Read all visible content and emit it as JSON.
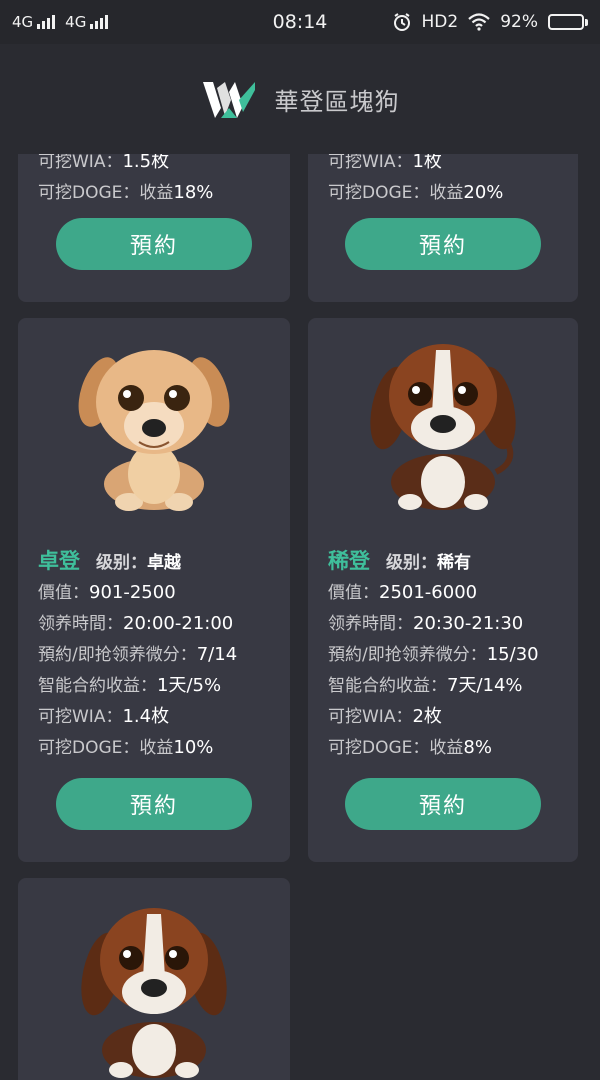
{
  "status_bar": {
    "signal1": "4G",
    "signal2": "4G",
    "time": "08:14",
    "hd": "HD2",
    "battery": "92%",
    "battery_level": 0.92
  },
  "header": {
    "title": "華登區塊狗",
    "logo_icon": "w-logo-icon"
  },
  "colors": {
    "accent": "#3fbf9b",
    "button": "#3ea88a",
    "card_bg": "#383943",
    "page_bg": "#2a2b31"
  },
  "partial_cards": [
    {
      "wia_label": "可挖WIA：",
      "wia_value": "1.5枚",
      "doge_label": "可挖DOGE：收益",
      "doge_value": "18%",
      "button": "預約"
    },
    {
      "wia_label": "可挖WIA：",
      "wia_value": "1枚",
      "doge_label": "可挖DOGE：收益",
      "doge_value": "20%",
      "button": "預約"
    }
  ],
  "cards": [
    {
      "name": "卓登",
      "level_label": "级别：",
      "level": "卓越",
      "price_label": "價值：",
      "price": "901-2500",
      "time_label": "领养時間：",
      "time": "20:00-21:00",
      "reserve_label": "預約/即抢领养微分：",
      "reserve": "7/14",
      "contract_label": "智能合約收益：",
      "contract": "1天/5%",
      "wia_label": "可挖WIA：",
      "wia": "1.4枚",
      "doge_label": "可挖DOGE：收益",
      "doge": "10%",
      "button": "預約",
      "dog_icon": "tan-puppy-icon"
    },
    {
      "name": "稀登",
      "level_label": "级别：",
      "level": "稀有",
      "price_label": "價值：",
      "price": "2501-6000",
      "time_label": "领养時間：",
      "time": "20:30-21:30",
      "reserve_label": "預約/即抢领养微分：",
      "reserve": "15/30",
      "contract_label": "智能合約收益：",
      "contract": "7天/14%",
      "wia_label": "可挖WIA：",
      "wia": "2枚",
      "doge_label": "可挖DOGE：收益",
      "doge": "8%",
      "button": "預約",
      "dog_icon": "beagle-puppy-icon"
    }
  ],
  "bottom_card": {
    "dog_icon": "beagle-puppy-icon"
  }
}
